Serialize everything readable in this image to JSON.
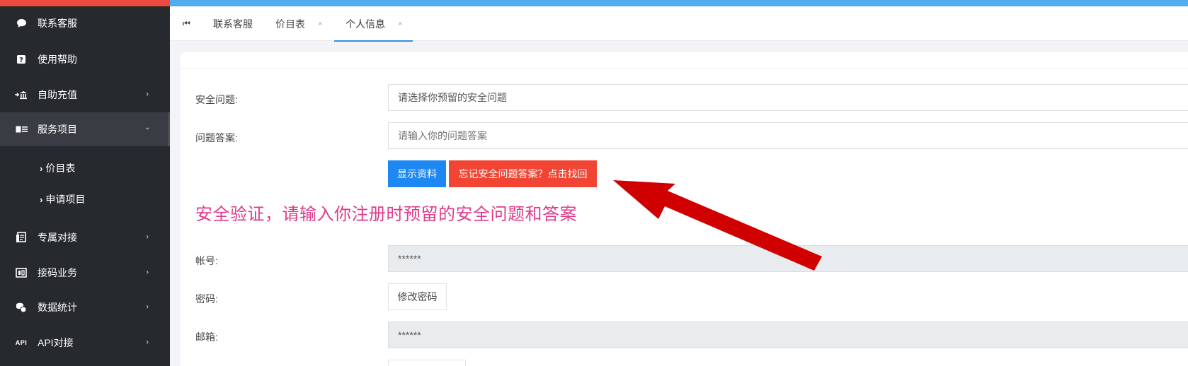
{
  "sidebar": {
    "items": [
      {
        "label": "联系客服",
        "icon": "chat-bubble-icon"
      },
      {
        "label": "使用帮助",
        "icon": "question-icon"
      },
      {
        "label": "自助充值",
        "icon": "bank-icon"
      },
      {
        "label": "服务项目",
        "icon": "id-card-icon"
      },
      {
        "label": "专属对接",
        "icon": "document-icon"
      },
      {
        "label": "接码业务",
        "icon": "sim-card-icon"
      },
      {
        "label": "数据统计",
        "icon": "coins-icon"
      },
      {
        "label": "API对接",
        "icon": "api-icon"
      }
    ],
    "subitems": [
      {
        "label": "价目表"
      },
      {
        "label": "申请项目"
      }
    ]
  },
  "tabs": {
    "first_icon": "⏮",
    "items": [
      {
        "label": "联系客服"
      },
      {
        "label": "价目表",
        "close": "×"
      },
      {
        "label": "个人信息",
        "close": "×"
      }
    ]
  },
  "form": {
    "security_question_label": "安全问题:",
    "security_question_value": "请选择你预留的安全问题",
    "answer_label": "问题答案:",
    "answer_placeholder": "请输入你的问题答案",
    "show_button": "显示资料",
    "forgot_button": "忘记安全问题答案？点击找回",
    "notice": "安全验证，请输入你注册时预留的安全问题和答案",
    "account_label": "帐号:",
    "account_value": "******",
    "password_label": "密码:",
    "password_button": "修改密码",
    "email_label": "邮箱:",
    "email_value": "******"
  },
  "colors": {
    "sidebar_bg": "#26292e",
    "top_red": "#ef4a3f",
    "top_blue": "#50aef0",
    "primary": "#1e88f2",
    "danger": "#f24432",
    "notice": "#e03a8c",
    "annotation_arrow": "#d10000"
  }
}
